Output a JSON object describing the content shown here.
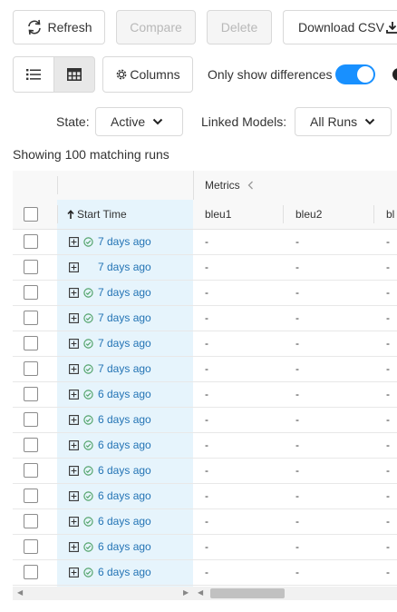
{
  "toolbar": {
    "refresh": "Refresh",
    "compare": "Compare",
    "delete": "Delete",
    "download": "Download CSV",
    "columns": "Columns",
    "only_diff": "Only show differences"
  },
  "filters": {
    "state_label": "State:",
    "state_value": "Active",
    "linked_label": "Linked Models:",
    "linked_value": "All Runs"
  },
  "summary": "Showing 100 matching runs",
  "grid": {
    "group_header": "Metrics",
    "columns": {
      "start_time": "Start Time",
      "bleu1": "bleu1",
      "bleu2": "bleu2",
      "bleu3_partial": "bl"
    },
    "rows": [
      {
        "start": "7 days ago",
        "status": "success",
        "bleu1": "-",
        "bleu2": "-",
        "bleu3": "-"
      },
      {
        "start": "7 days ago",
        "status": "none",
        "bleu1": "-",
        "bleu2": "-",
        "bleu3": "-"
      },
      {
        "start": "7 days ago",
        "status": "success",
        "bleu1": "-",
        "bleu2": "-",
        "bleu3": "-"
      },
      {
        "start": "7 days ago",
        "status": "success",
        "bleu1": "-",
        "bleu2": "-",
        "bleu3": "-"
      },
      {
        "start": "7 days ago",
        "status": "success",
        "bleu1": "-",
        "bleu2": "-",
        "bleu3": "-"
      },
      {
        "start": "7 days ago",
        "status": "success",
        "bleu1": "-",
        "bleu2": "-",
        "bleu3": "-"
      },
      {
        "start": "6 days ago",
        "status": "success",
        "bleu1": "-",
        "bleu2": "-",
        "bleu3": "-"
      },
      {
        "start": "6 days ago",
        "status": "success",
        "bleu1": "-",
        "bleu2": "-",
        "bleu3": "-"
      },
      {
        "start": "6 days ago",
        "status": "success",
        "bleu1": "-",
        "bleu2": "-",
        "bleu3": "-"
      },
      {
        "start": "6 days ago",
        "status": "success",
        "bleu1": "-",
        "bleu2": "-",
        "bleu3": "-"
      },
      {
        "start": "6 days ago",
        "status": "success",
        "bleu1": "-",
        "bleu2": "-",
        "bleu3": "-"
      },
      {
        "start": "6 days ago",
        "status": "success",
        "bleu1": "-",
        "bleu2": "-",
        "bleu3": "-"
      },
      {
        "start": "6 days ago",
        "status": "success",
        "bleu1": "-",
        "bleu2": "-",
        "bleu3": "-"
      },
      {
        "start": "6 days ago",
        "status": "success",
        "bleu1": "-",
        "bleu2": "-",
        "bleu3": "-"
      }
    ]
  },
  "colors": {
    "accent": "#1890ff",
    "link": "#2474b5",
    "success": "#52a36a",
    "pinned_bg": "#e6f4fc"
  },
  "icons": {
    "refresh": "refresh-icon",
    "download": "download-icon",
    "list_view": "list-icon",
    "table_view": "table-icon",
    "columns": "gear-icon",
    "chevron": "chevron-down-icon",
    "expand": "plus-square-icon",
    "status": "check-circle-icon",
    "sort": "arrow-up-icon",
    "collapse": "chevron-left-icon"
  }
}
